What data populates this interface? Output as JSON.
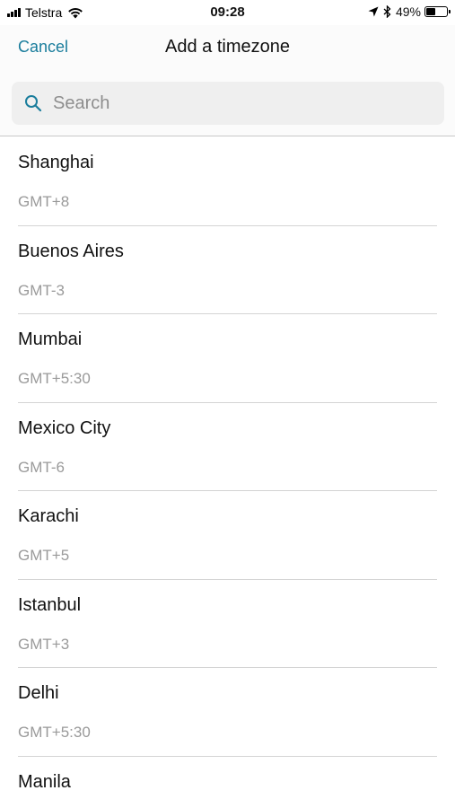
{
  "status_bar": {
    "carrier": "Telstra",
    "time": "09:28",
    "battery_text": "49%",
    "battery_level": 0.49
  },
  "nav": {
    "cancel_label": "Cancel",
    "title": "Add a timezone"
  },
  "search": {
    "placeholder": "Search",
    "value": ""
  },
  "colors": {
    "accent": "#1a7d9c",
    "secondary_text": "#9a9a9a"
  },
  "timezones": [
    {
      "name": "Shanghai",
      "offset": "GMT+8"
    },
    {
      "name": "Buenos Aires",
      "offset": "GMT-3"
    },
    {
      "name": "Mumbai",
      "offset": "GMT+5:30"
    },
    {
      "name": "Mexico City",
      "offset": "GMT-6"
    },
    {
      "name": "Karachi",
      "offset": "GMT+5"
    },
    {
      "name": "Istanbul",
      "offset": "GMT+3"
    },
    {
      "name": "Delhi",
      "offset": "GMT+5:30"
    },
    {
      "name": "Manila",
      "offset": ""
    }
  ]
}
